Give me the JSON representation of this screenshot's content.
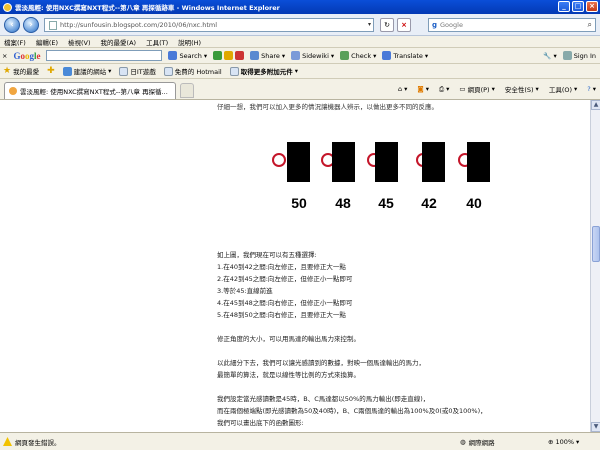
{
  "window": {
    "title": "雲淡風輕: 使用NXC撰寫NXT程式--第八章 再探循跡車 - Windows Internet Explorer"
  },
  "address": {
    "url": "http://sunfousin.blogspot.com/2010/06/nxc.html",
    "search_placeholder": "Google"
  },
  "menu": {
    "items": [
      "檔案(F)",
      "編輯(E)",
      "檢視(V)",
      "我的最愛(A)",
      "工具(T)",
      "說明(H)"
    ]
  },
  "google_toolbar": {
    "logo": "Google",
    "search_label": "Search",
    "share_label": "Share",
    "sidewiki_label": "Sidewiki",
    "check_label": "Check",
    "translate_label": "Translate",
    "signin_label": "Sign In"
  },
  "favorites": {
    "label": "我的最愛",
    "items": [
      "建議的網站",
      "日IT遊戲",
      "免費的 Hotmail",
      "取得更多附加元件"
    ]
  },
  "tabs": {
    "active": "雲淡風輕: 使用NXC撰寫NXT程式--第八章 再探循..."
  },
  "commands": {
    "page": "網頁(P)",
    "safety": "安全性(S)",
    "tools": "工具(O)"
  },
  "content": {
    "top_text": "仔細一想，我們可以加入更多的情況讓機器人辨示，以做出更多不同的反應。",
    "figure_values": [
      "50",
      "48",
      "45",
      "42",
      "40"
    ],
    "options_intro": "如上圖，我們現在可以有五種選擇:",
    "options": [
      "1.在40到42之間:向左修正，且要修正大一點",
      "2.在42到45之間:向左修正，但修正小一點即可",
      "3.等於45:直線前進",
      "4.在45到48之間:向右修正，但修正小一點即可",
      "5.在48到50之間:向右修正，且要修正大一點"
    ],
    "para2": "修正角度的大小，可以用馬達的輸出馬力來控制。",
    "para3_line1": "以此細分下去，我們可以讓光感讀到的數據，對映一個馬達輸出的馬力，",
    "para3_line2": "最簡單的算法，就是以線性等比例的方式來換算。",
    "para4_line1": "我們設定當光感讀數是45時，B、C馬達都以50%的馬力輸出(即走直線)，",
    "para4_line2": "而在兩個極端點(即光感讀數為50及40時)，B、C兩個馬達的輸出為100%及0(或0及100%)，",
    "para4_line3": "我們可以畫出底下的函數圖形:"
  },
  "status": {
    "left": "網頁發生錯誤。",
    "zone": "網際網路",
    "zoom": "100%"
  },
  "colors": {
    "circle": "#c4162a",
    "title_bar": "#0a4ed8"
  }
}
